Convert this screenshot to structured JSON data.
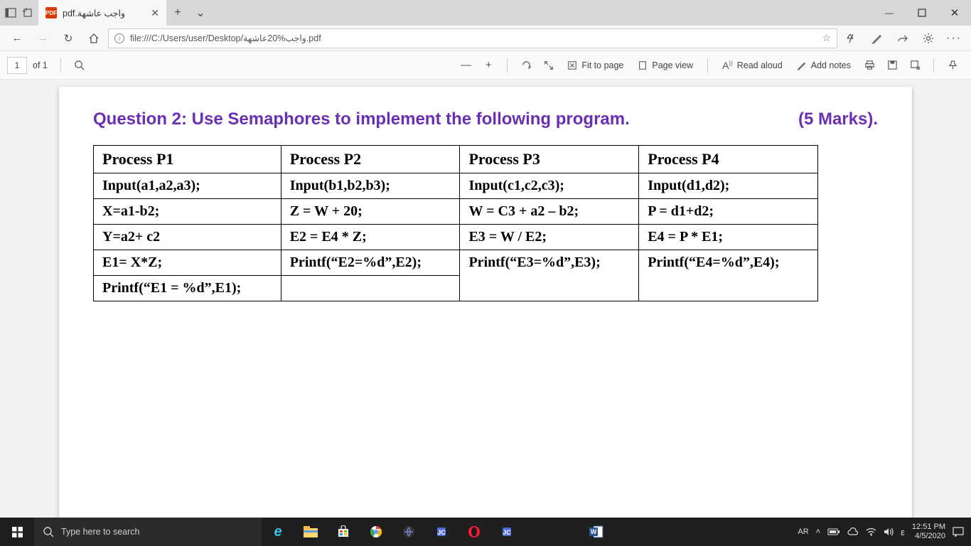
{
  "titlebar": {
    "tab_title": "pdf.واجب عاشهة",
    "pdf_badge": "PDF"
  },
  "addressbar": {
    "url": "file:///C:/Users/user/Desktop/واجب%20عاشهة.pdf"
  },
  "pdfbar": {
    "current_page": "1",
    "of_label": "of 1",
    "fit_label": "Fit to page",
    "pageview_label": "Page view",
    "readaloud_label": "Read aloud",
    "addnotes_label": "Add notes"
  },
  "document": {
    "question_text": "Question 2: Use Semaphores to implement the following program.",
    "marks_text": "(5 Marks).",
    "headers": [
      "Process P1",
      "Process P2",
      "Process P3",
      "Process P4"
    ],
    "rows": [
      [
        "Input(a1,a2,a3);",
        "Input(b1,b2,b3);",
        "Input(c1,c2,c3);",
        "Input(d1,d2);"
      ],
      [
        "X=a1-b2;",
        "Z = W + 20;",
        "W = C3 + a2 – b2;",
        "P = d1+d2;"
      ],
      [
        "Y=a2+ c2",
        "E2 = E4 * Z;",
        "E3 = W / E2;",
        "E4 = P * E1;"
      ],
      [
        "E1= X*Z;",
        "Printf(“E2=%d”,E2);",
        "Printf(“E3=%d”,E3);",
        "Printf(“E4=%d”,E4);"
      ],
      [
        "Printf(“E1 = %d”,E1);",
        "",
        "",
        ""
      ]
    ]
  },
  "taskbar": {
    "search_placeholder": "Type here to search",
    "lang": "AR",
    "ime": "ε",
    "time": "12:51 PM",
    "date": "4/5/2020"
  }
}
